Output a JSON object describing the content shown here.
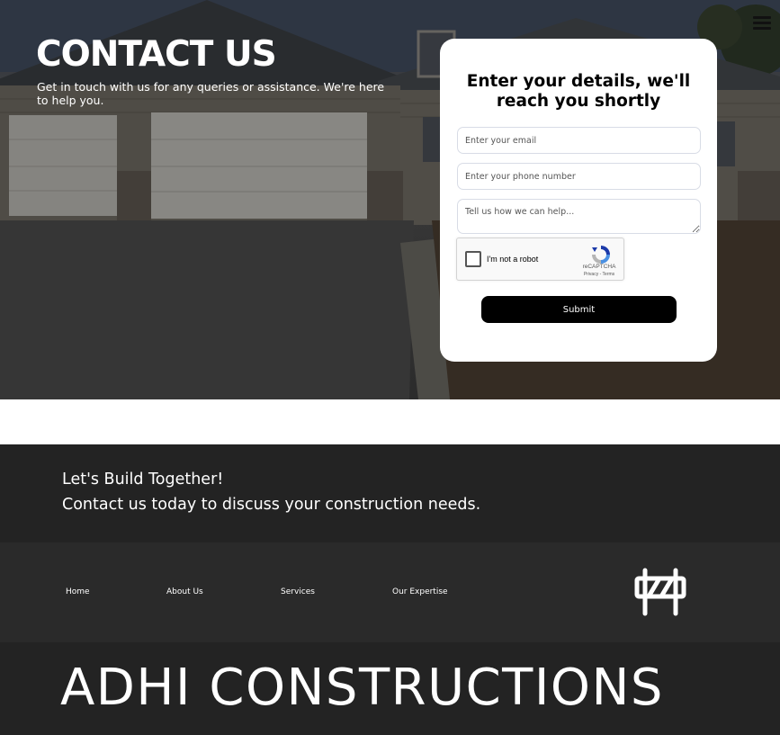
{
  "hero": {
    "title": "CONTACT US",
    "subtitle": "Get in touch with us for any queries or assistance. We're here to help you.",
    "menu_icon": "hamburger-menu-icon"
  },
  "form": {
    "title": "Enter your details, we'll reach you shortly",
    "email_placeholder": "Enter your email",
    "phone_placeholder": "Enter your phone number",
    "message_placeholder": "Tell us how we can help...",
    "captcha": {
      "label": "I'm not a robot",
      "brand": "reCAPTCHA",
      "links": "Privacy - Terms"
    },
    "submit_label": "Submit"
  },
  "cta": {
    "line1": "Let's Build Together!",
    "line2": "Contact us today to discuss your construction needs."
  },
  "footer": {
    "nav": [
      "Home",
      "About Us",
      "Services",
      "Our Expertise"
    ],
    "brand_icon": "road-barrier-icon",
    "brand_name": "ADHI CONSTRUCTIONS"
  },
  "colors": {
    "card_bg": "#ffffff",
    "button_bg": "#000000",
    "footer_dark": "#232323",
    "footer_nav_bg": "#2a2a2a"
  }
}
